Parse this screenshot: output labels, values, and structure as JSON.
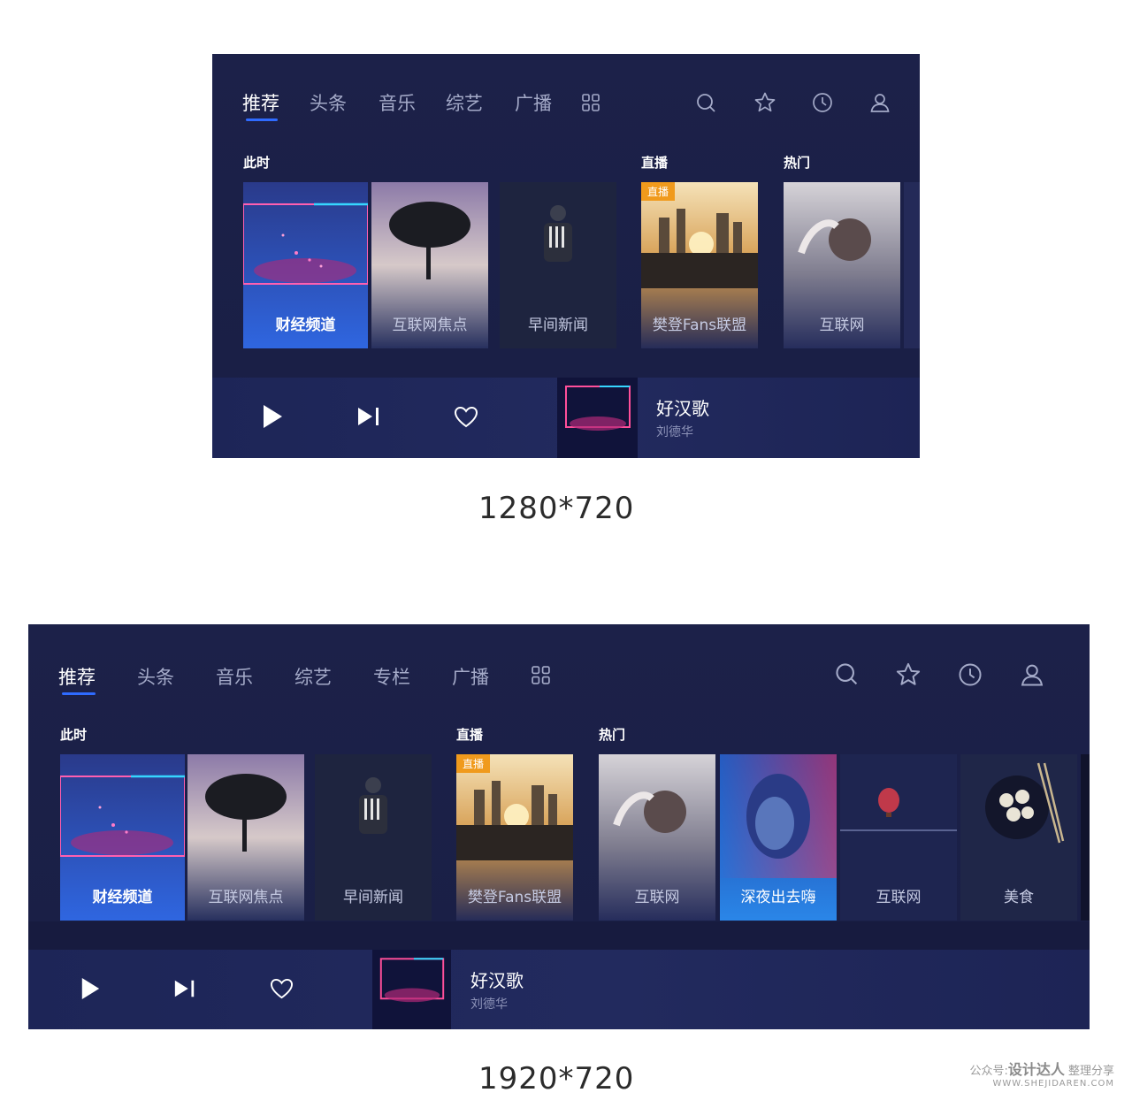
{
  "mock1": {
    "tabs": [
      "推荐",
      "头条",
      "音乐",
      "综艺",
      "广播"
    ],
    "sections": {
      "now": "此时",
      "live": "直播",
      "hot": "热门"
    },
    "cards": [
      "财经频道",
      "互联网焦点",
      "早间新闻",
      "樊登Fans联盟",
      "互联网"
    ],
    "live_badge": "直播",
    "now_playing": {
      "title": "好汉歌",
      "artist": "刘德华"
    },
    "caption": "1280*720"
  },
  "mock2": {
    "tabs": [
      "推荐",
      "头条",
      "音乐",
      "综艺",
      "专栏",
      "广播"
    ],
    "sections": {
      "now": "此时",
      "live": "直播",
      "hot": "热门"
    },
    "cards": [
      "财经频道",
      "互联网焦点",
      "早间新闻",
      "樊登Fans联盟",
      "互联网",
      "深夜出去嗨",
      "互联网",
      "美食"
    ],
    "live_badge": "直播",
    "now_playing": {
      "title": "好汉歌",
      "artist": "刘德华"
    },
    "caption": "1920*720"
  },
  "watermark": {
    "prefix": "公众号:",
    "brand": "设计达人",
    "suffix": "整理分享",
    "url": "WWW.SHEJIDAREN.COM"
  },
  "icons": [
    "grid-icon",
    "search-icon",
    "star-icon",
    "clock-icon",
    "user-icon",
    "play-icon",
    "next-icon",
    "heart-icon"
  ],
  "colors": {
    "background": "#1b2048",
    "accent": "#2f6bff",
    "live_badge": "#f09a1c"
  }
}
